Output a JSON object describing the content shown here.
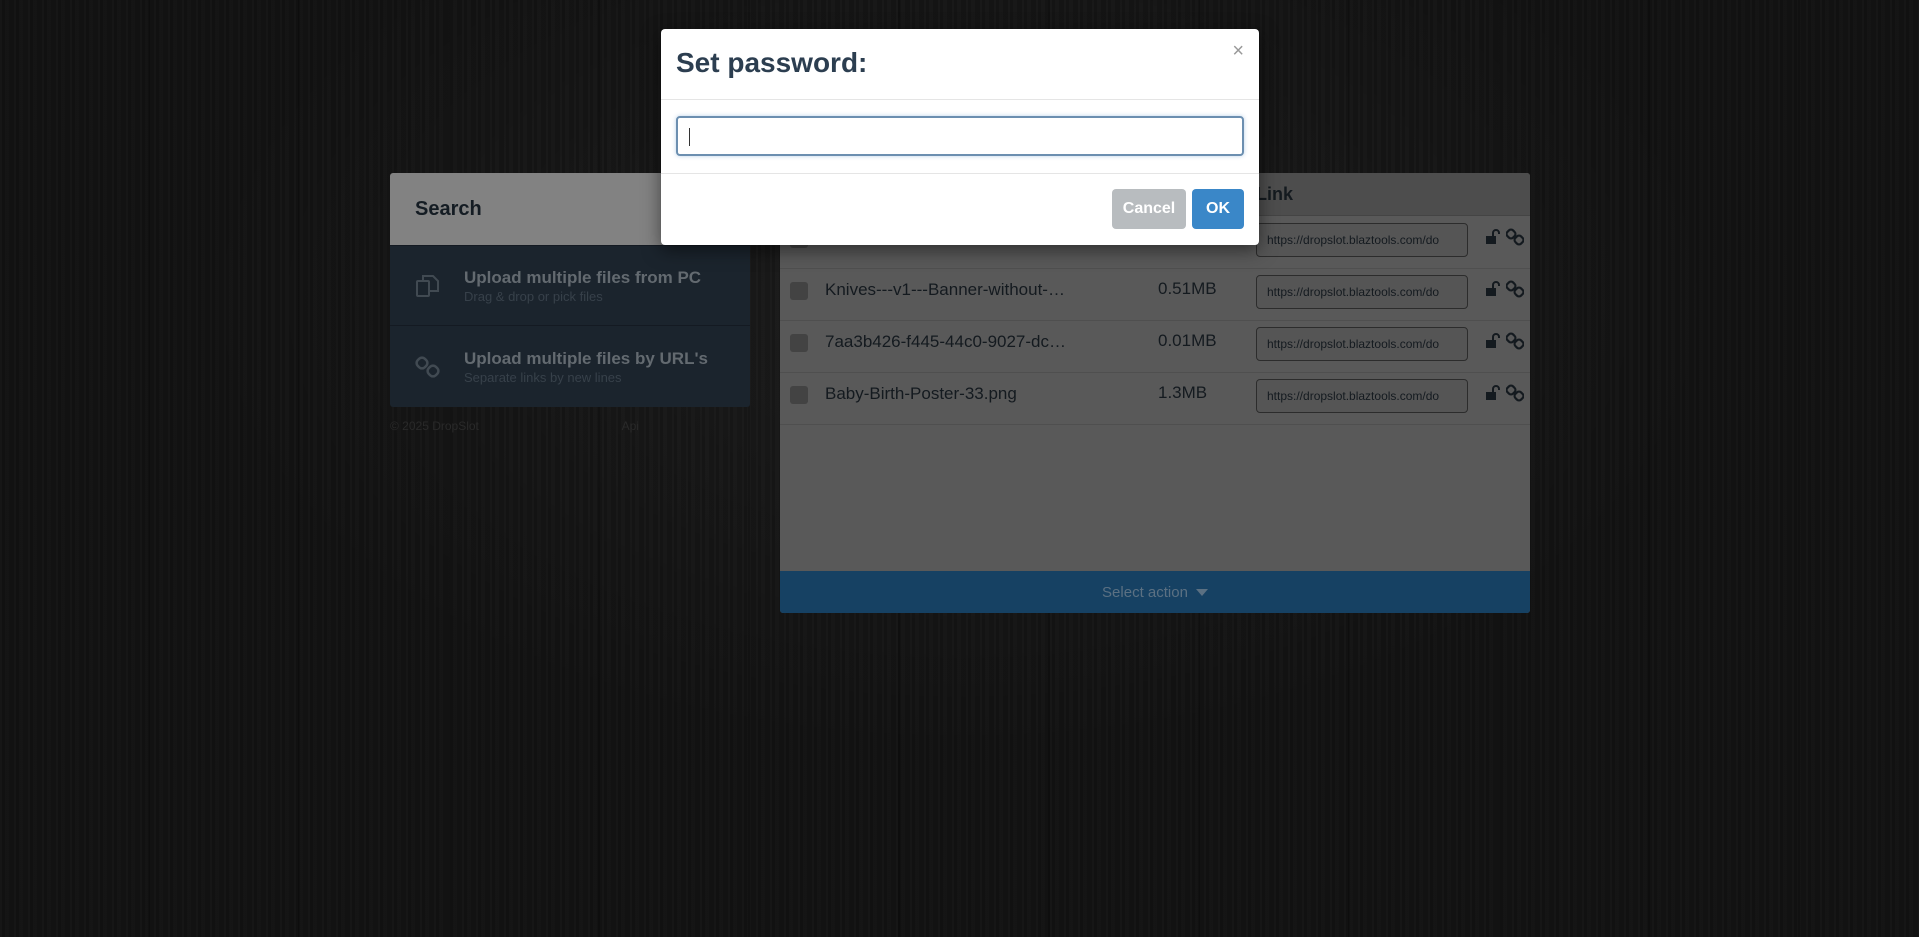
{
  "left_panel": {
    "search_label": "Search",
    "uploads": [
      {
        "title": "Upload multiple files from PC",
        "subtitle": "Drag & drop or pick files",
        "icon": "copy-files-icon"
      },
      {
        "title": "Upload multiple files by URL's",
        "subtitle": "Separate links by new lines",
        "icon": "link-chain-icon"
      }
    ],
    "footer": {
      "copyright": "© 2025 DropSlot",
      "extra": "Api"
    }
  },
  "file_table": {
    "headers": {
      "link": "Link"
    },
    "rows": [
      {
        "name": "",
        "size": "",
        "link": "https://dropslot.blaztools.com/do"
      },
      {
        "name": "Knives---v1---Banner-without-…",
        "size": "0.51MB",
        "link": "https://dropslot.blaztools.com/do"
      },
      {
        "name": "7aa3b426-f445-44c0-9027-dc…",
        "size": "0.01MB",
        "link": "https://dropslot.blaztools.com/do"
      },
      {
        "name": "Baby-Birth-Poster-33.png",
        "size": "1.3MB",
        "link": "https://dropslot.blaztools.com/do"
      }
    ],
    "select_action_label": "Select action"
  },
  "modal": {
    "title": "Set password:",
    "close_glyph": "×",
    "input_value": "",
    "cancel_label": "Cancel",
    "ok_label": "OK"
  },
  "colors": {
    "accent": "#3a87c8",
    "modal_title": "#2c3e50",
    "cancel_button": "#b8bcbf",
    "select_action_bar": "#1f5a89"
  }
}
